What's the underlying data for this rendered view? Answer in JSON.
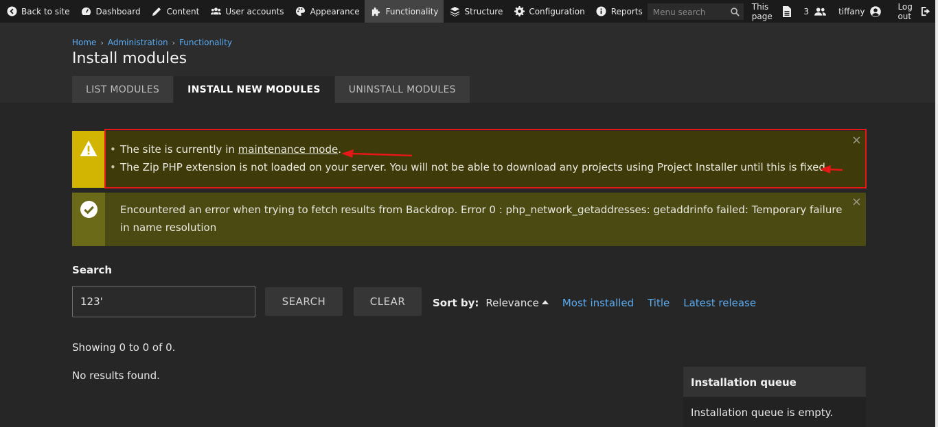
{
  "adminbar": {
    "items": [
      {
        "label": "Back to site",
        "icon": "arrow-circle-left-icon"
      },
      {
        "label": "Dashboard",
        "icon": "gauge-icon"
      },
      {
        "label": "Content",
        "icon": "pencil-icon"
      },
      {
        "label": "User accounts",
        "icon": "users-icon"
      },
      {
        "label": "Appearance",
        "icon": "palette-icon"
      },
      {
        "label": "Functionality",
        "icon": "puzzle-icon",
        "active": true
      },
      {
        "label": "Structure",
        "icon": "stack-icon"
      },
      {
        "label": "Configuration",
        "icon": "gear-icon"
      },
      {
        "label": "Reports",
        "icon": "info-icon"
      }
    ],
    "search_placeholder": "Menu search",
    "this_page": "This page",
    "user_count": "3",
    "username": "tiffany",
    "logout": "Log out"
  },
  "breadcrumb": [
    "Home",
    "Administration",
    "Functionality"
  ],
  "page_title": "Install modules",
  "tabs": [
    {
      "label": "LIST MODULES"
    },
    {
      "label": "INSTALL NEW MODULES",
      "active": true
    },
    {
      "label": "UNINSTALL MODULES"
    }
  ],
  "warning": {
    "line1_prefix": "The site is currently in ",
    "line1_link": "maintenance mode",
    "line1_suffix": ".",
    "line2": "The Zip PHP extension is not loaded on your server. You will not be able to download any projects using Project Installer until this is fixed."
  },
  "status_message": "Encountered an error when trying to fetch results from Backdrop. Error 0 : php_network_getaddresses: getaddrinfo failed: Temporary failure in name resolution",
  "close_glyph": "×",
  "search": {
    "label": "Search",
    "value": "123'",
    "search_button": "SEARCH",
    "clear_button": "CLEAR"
  },
  "sort": {
    "label": "Sort by:",
    "current": "Relevance",
    "options": [
      "Most installed",
      "Title",
      "Latest release"
    ]
  },
  "showing": "Showing 0 to 0 of 0.",
  "no_results": "No results found.",
  "queue": {
    "title": "Installation queue",
    "empty_text": "Installation queue is empty."
  },
  "colors": {
    "link": "#5aaaf0",
    "warning_accent": "#d2b403",
    "annotation_red": "#e51717"
  }
}
